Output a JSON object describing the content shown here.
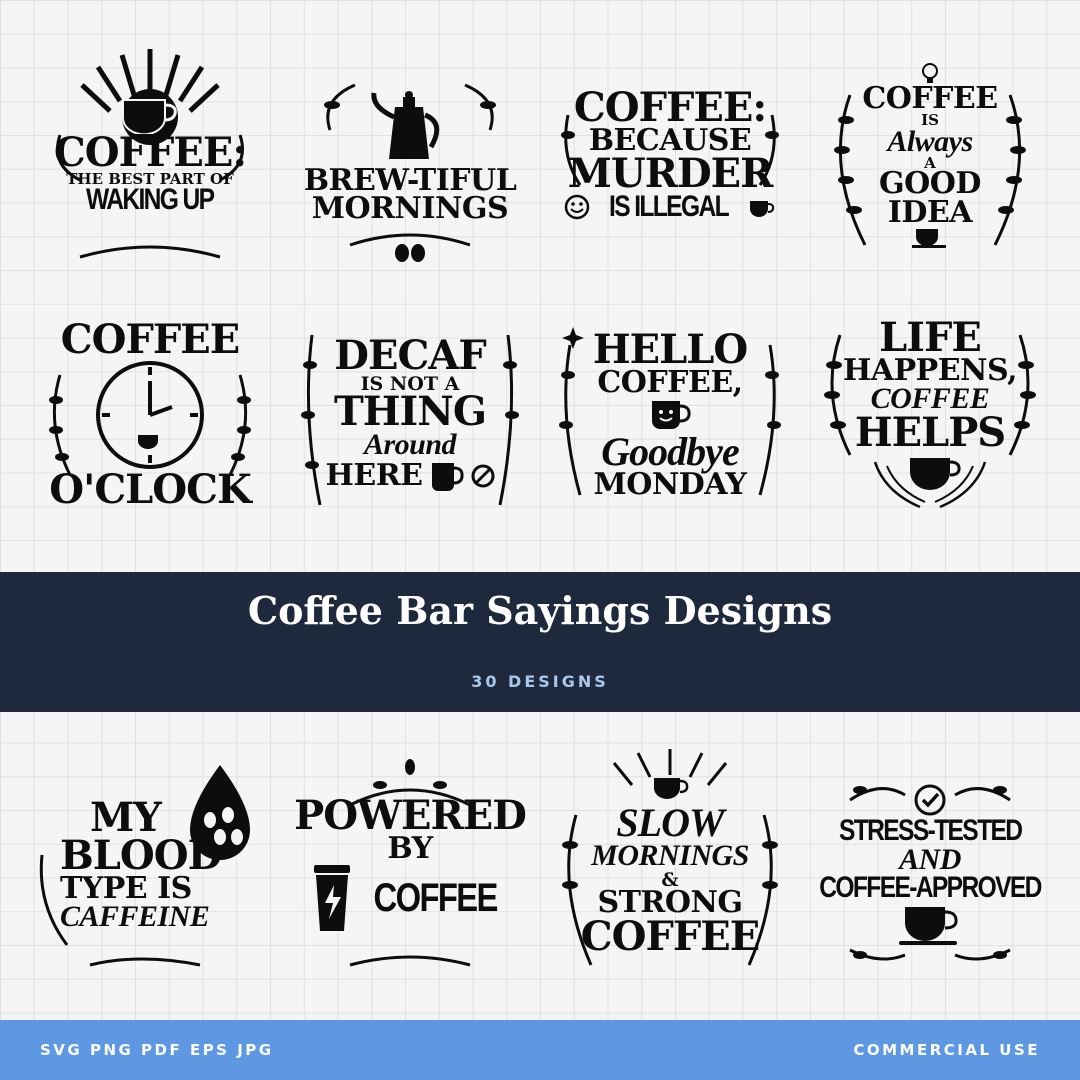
{
  "designs": [
    {
      "lines": [
        "COFFEE:",
        "THE BEST PART OF",
        "WAKING UP"
      ]
    },
    {
      "lines": [
        "BREW-TIFUL",
        "MORNINGS"
      ]
    },
    {
      "lines": [
        "COFFEE:",
        "BECAUSE",
        "MURDER",
        "IS ILLEGAL"
      ]
    },
    {
      "lines": [
        "COFFEE",
        "IS",
        "Always",
        "A",
        "GOOD",
        "IDEA"
      ]
    },
    {
      "lines": [
        "COFFEE",
        "O'CLOCK"
      ]
    },
    {
      "lines": [
        "DECAF",
        "IS NOT A",
        "THING",
        "Around",
        "HERE"
      ]
    },
    {
      "lines": [
        "HELLO",
        "COFFEE,",
        "Goodbye",
        "MONDAY"
      ]
    },
    {
      "lines": [
        "LIFE",
        "HAPPENS,",
        "COFFEE",
        "HELPS"
      ]
    },
    {
      "lines": [
        "MY",
        "BLOOD",
        "TYPE IS",
        "CAFFEINE"
      ]
    },
    {
      "lines": [
        "POWERED",
        "BY",
        "COFFEE"
      ]
    },
    {
      "lines": [
        "SLOW",
        "MORNINGS",
        "&",
        "STRONG",
        "COFFEE"
      ]
    },
    {
      "lines": [
        "STRESS-TESTED",
        "AND",
        "COFFEE-APPROVED"
      ]
    }
  ],
  "banner": {
    "title": "Coffee Bar Sayings Designs",
    "subtitle": "30 DESIGNS"
  },
  "footer": {
    "formats": "SVG PNG PDF EPS JPG",
    "license": "COMMERCIAL USE"
  },
  "colors": {
    "banner": "#1e293d",
    "footer": "#5e98e3",
    "subtitle": "#a9c8ea",
    "ink": "#0d0d0d"
  },
  "icons": [
    "coffee-cup-icon",
    "kettle-icon",
    "smiley-icon",
    "lightbulb-icon",
    "clock-icon",
    "no-sign-icon",
    "smiling-mug-icon",
    "hands-cup-icon",
    "coffee-bean-drop-icon",
    "to-go-cup-icon",
    "checkmark-icon",
    "laurel-icon",
    "sparkle-icon"
  ]
}
